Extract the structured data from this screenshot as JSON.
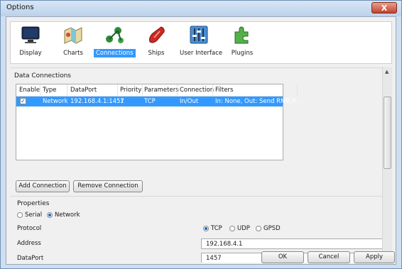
{
  "window": {
    "title": "Options",
    "close_glyph": "X"
  },
  "toolbar": {
    "items": [
      {
        "label": "Display",
        "icon": "display-icon"
      },
      {
        "label": "Charts",
        "icon": "charts-icon"
      },
      {
        "label": "Connections",
        "icon": "connections-icon",
        "active": true
      },
      {
        "label": "Ships",
        "icon": "ships-icon"
      },
      {
        "label": "User Interface",
        "icon": "user-interface-icon"
      },
      {
        "label": "Plugins",
        "icon": "plugins-icon"
      }
    ]
  },
  "data_connections": {
    "label": "Data Connections",
    "columns": [
      "Enable",
      "Type",
      "DataPort",
      "Priority",
      "Parameters",
      "Connection",
      "Filters"
    ],
    "rows": [
      {
        "enabled": true,
        "type": "Network",
        "dataport": "192.168.4.1:1457",
        "priority": "1",
        "parameters": "TCP",
        "connection": "In/Out",
        "filters": "In: None, Out: Send RMB,R..."
      }
    ],
    "add_button": "Add Connection",
    "remove_button": "Remove Connection"
  },
  "properties": {
    "label": "Properties",
    "serial_label": "Serial",
    "network_label": "Network",
    "selected_type": "Network",
    "protocol_label": "Protocol",
    "protocol_options": [
      "TCP",
      "UDP",
      "GPSD"
    ],
    "protocol_selected": "TCP",
    "address_label": "Address",
    "address_value": "192.168.4.1",
    "dataport_label": "DataPort",
    "dataport_value": "1457"
  },
  "footer": {
    "ok": "OK",
    "cancel": "Cancel",
    "apply": "Apply"
  },
  "colors": {
    "selection": "#3399ff",
    "titlebar": "#bcd2ea",
    "close": "#c4422c"
  }
}
